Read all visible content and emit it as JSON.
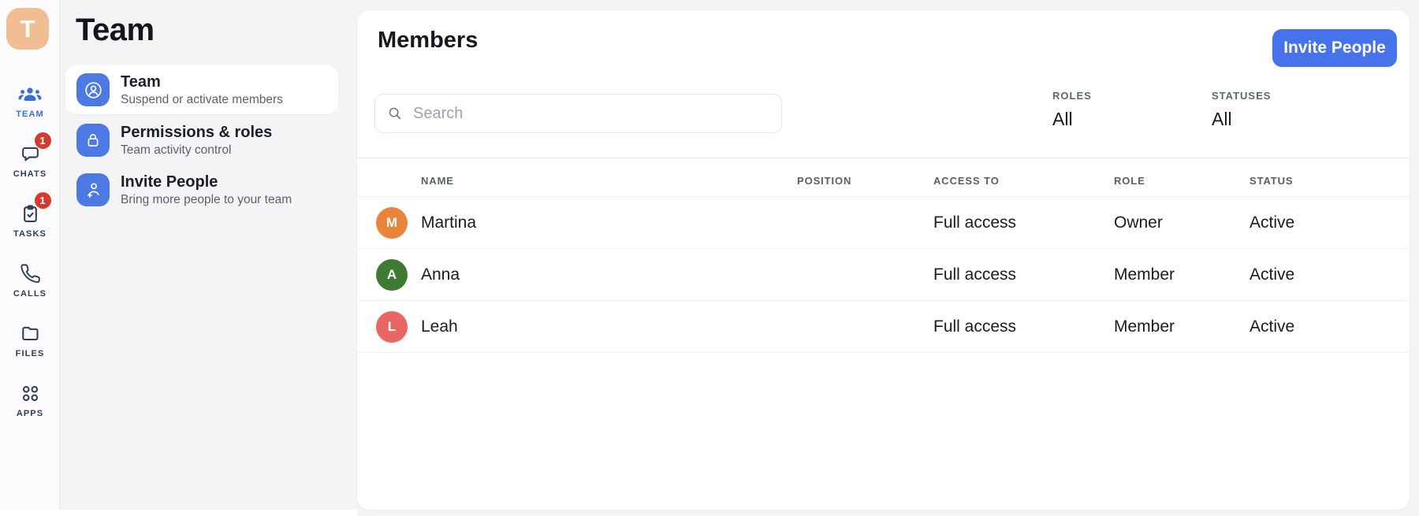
{
  "app": {
    "logo_letter": "T",
    "colors": {
      "logo_bg": "#F1BD92",
      "accent_blue": "#4673E9",
      "icon_square_blue": "#4C79E4",
      "badge_red": "#D53A2E",
      "rail_active_blue": "#3B6ED8"
    }
  },
  "rail": {
    "items": [
      {
        "label": "TEAM",
        "icon": "team-icon",
        "active": true,
        "badge": null
      },
      {
        "label": "CHATS",
        "icon": "chats-icon",
        "active": false,
        "badge": "1"
      },
      {
        "label": "TASKS",
        "icon": "tasks-icon",
        "active": false,
        "badge": "1"
      },
      {
        "label": "CALLS",
        "icon": "calls-icon",
        "active": false,
        "badge": null
      },
      {
        "label": "FILES",
        "icon": "files-icon",
        "active": false,
        "badge": null
      },
      {
        "label": "APPS",
        "icon": "apps-icon",
        "active": false,
        "badge": null
      }
    ]
  },
  "panel": {
    "title": "Team",
    "items": [
      {
        "title": "Team",
        "subtitle": "Suspend or activate members",
        "icon": "member-icon",
        "selected": true
      },
      {
        "title": "Permissions & roles",
        "subtitle": "Team activity control",
        "icon": "lock-icon",
        "selected": false
      },
      {
        "title": "Invite People",
        "subtitle": "Bring more people to your team",
        "icon": "invite-icon",
        "selected": false
      }
    ]
  },
  "main": {
    "title": "Members",
    "invite_button": "Invite People",
    "search_placeholder": "Search",
    "filters": [
      {
        "label": "ROLES",
        "value": "All"
      },
      {
        "label": "STATUSES",
        "value": "All"
      }
    ],
    "table": {
      "headers": [
        "NAME",
        "POSITION",
        "ACCESS TO",
        "ROLE",
        "STATUS"
      ],
      "rows": [
        {
          "name": "Martina",
          "initial": "M",
          "avatar_color": "#E8843C",
          "position": "",
          "access": "Full access",
          "role": "Owner",
          "status": "Active"
        },
        {
          "name": "Anna",
          "initial": "A",
          "avatar_color": "#3E7A33",
          "position": "",
          "access": "Full access",
          "role": "Member",
          "status": "Active"
        },
        {
          "name": "Leah",
          "initial": "L",
          "avatar_color": "#E96663",
          "position": "",
          "access": "Full access",
          "role": "Member",
          "status": "Active"
        }
      ]
    }
  }
}
